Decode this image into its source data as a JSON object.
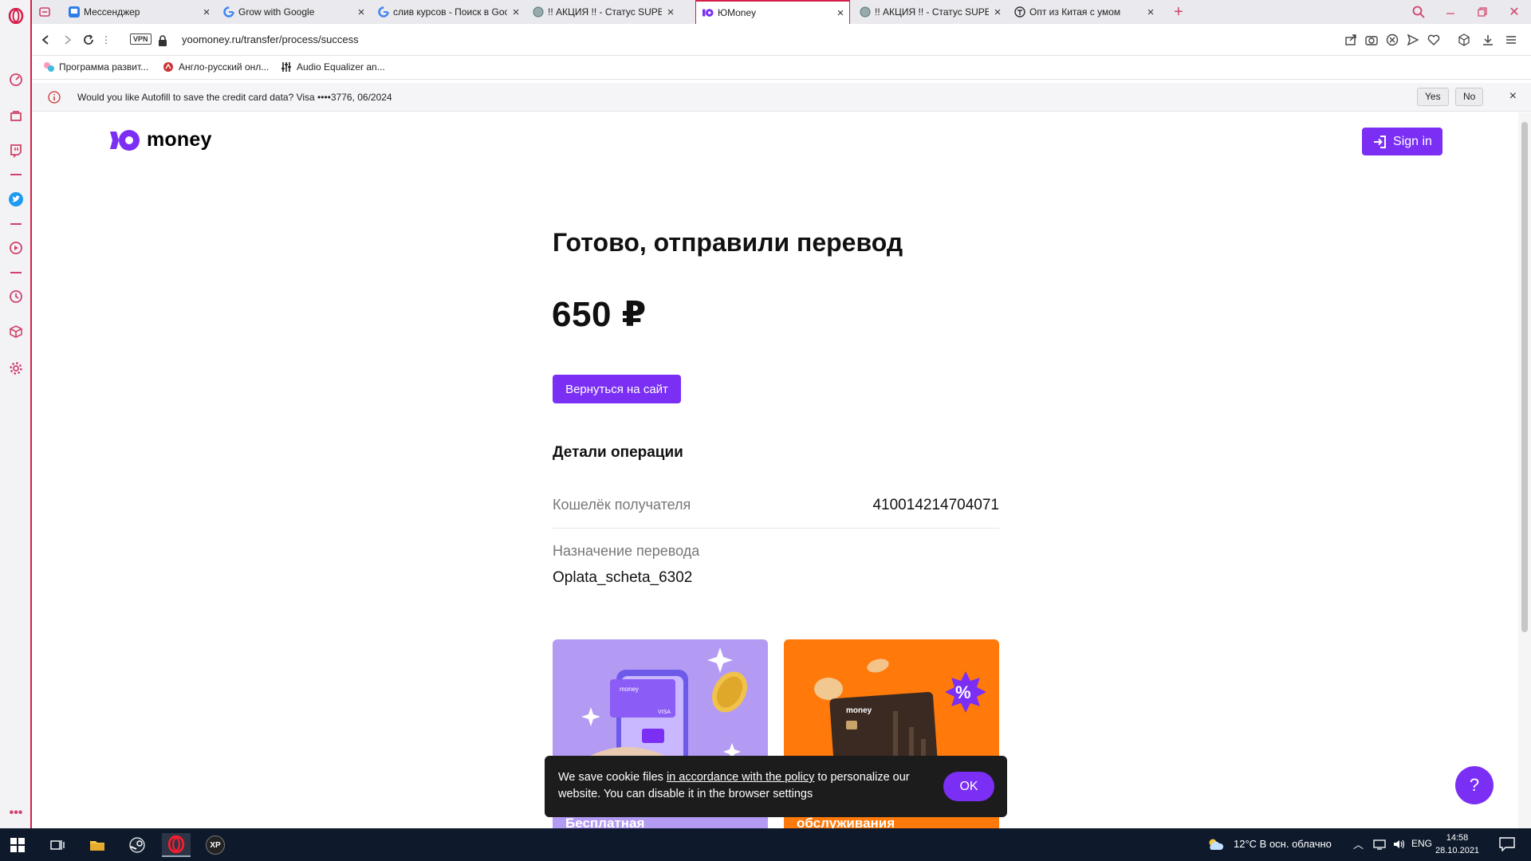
{
  "browser": {
    "tabs": [
      {
        "title": "Мессенджер",
        "active": false
      },
      {
        "title": "Grow with Google",
        "active": false
      },
      {
        "title": "слив курсов - Поиск в Goo",
        "active": false
      },
      {
        "title": "!! АКЦИЯ !! - Статус SUPER",
        "active": false
      },
      {
        "title": "ЮMoney",
        "active": true
      },
      {
        "title": "!! АКЦИЯ !! - Статус SUPER",
        "active": false
      },
      {
        "title": "Опт из Китая с умом",
        "active": false
      }
    ],
    "vpn_label": "VPN",
    "url": "yoomoney.ru/transfer/process/success",
    "bookmarks": [
      "Программа развит...",
      "Англо-русский онл...",
      "Audio Equalizer an..."
    ],
    "autofill": {
      "message": "Would you like Autofill to save the credit card data? Visa  ••••3776, 06/2024",
      "yes": "Yes",
      "no": "No",
      "close": "×"
    }
  },
  "page": {
    "logo_text": "money",
    "sign_in": "Sign in",
    "title": "Готово, отправили перевод",
    "amount": "650 ₽",
    "back_button": "Вернуться на сайт",
    "details_title": "Детали операции",
    "recipient_label": "Кошелёк получателя",
    "recipient_value": "4100142147040​71",
    "purpose_label": "Назначение перевода",
    "purpose_value": "Oplata_scheta_6302",
    "promo_left": "Бесплатная",
    "promo_right": "обслуживания",
    "card_brand": "money",
    "card_network": "VISA",
    "cookie": {
      "text_before": "We save cookie files ",
      "link": "in accordance with the policy",
      "text_after": " to personalize our website. You can disable it in the browser settings",
      "ok": "OK"
    },
    "help": "?"
  },
  "taskbar": {
    "weather": "12°C  В осн. облачно",
    "lang": "ENG",
    "time": "14:58",
    "date": "28.10.2021",
    "xp_label": "XP"
  },
  "colors": {
    "accent": "#7b2ff5",
    "opera_red": "#d51f49",
    "promo_purple": "#b39bf3",
    "promo_orange": "#ff7a0a"
  }
}
